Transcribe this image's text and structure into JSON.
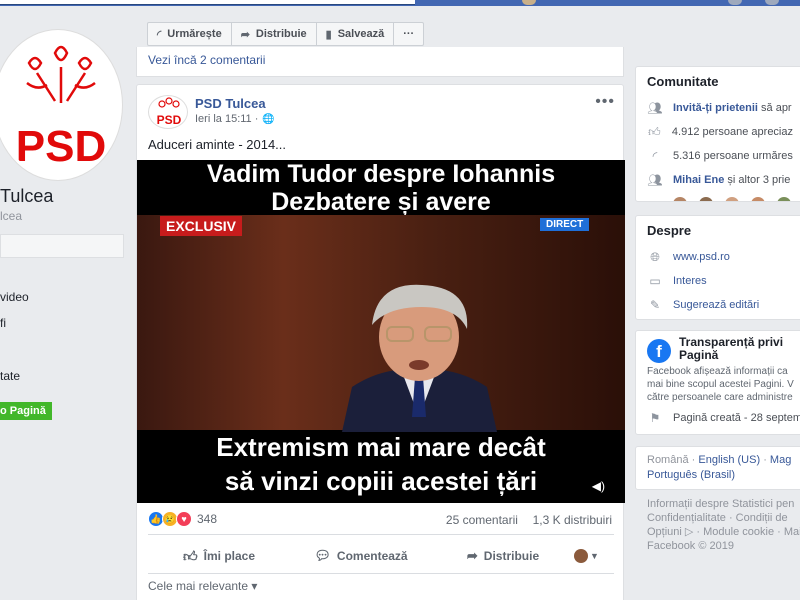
{
  "left": {
    "page_name": "Tulcea",
    "page_handle": "lcea",
    "nav": [
      "video",
      "fi",
      "tate"
    ],
    "create_page_label": "o Pagină"
  },
  "action_bar": {
    "follow": "Urmărește",
    "share": "Distribuie",
    "save": "Salvează",
    "more": "···"
  },
  "prev_post": {
    "more_comments": "Vezi încă 2 comentarii"
  },
  "post": {
    "author": "PSD Tulcea",
    "time": "Ieri la 15:11 ·",
    "text": "Aduceri aminte - 2014...",
    "video": {
      "title_line1": "Vadim Tudor despre Iohannis",
      "title_line2": "Dezbatere și avere",
      "tag_exclusive": "EXCLUSIV",
      "tag_direct": "DIRECT",
      "caption_line1": "Extremism mai mare decât",
      "caption_line2": "să vinzi copiii acestei țări"
    },
    "reaction_count": "348",
    "comments": "25 comentarii",
    "shares": "1,3 K distribuiri",
    "actions": {
      "like": "Îmi place",
      "comment": "Comentează",
      "share": "Distribuie"
    },
    "sort_label": "Cele mai relevante ▾",
    "logo_text": "PSD"
  },
  "community": {
    "title": "Comunitate",
    "invite": "Invită-ți prietenii",
    "invite_suffix": " să apr",
    "likes": "4.912 persoane apreciaz",
    "followers": "5.316 persoane urmăres",
    "friends_prefix": "Mihai Ene",
    "friends_suffix": " și altor 3 prie"
  },
  "about": {
    "title": "Despre",
    "website": "www.psd.ro",
    "category": "Interes",
    "suggest": "Sugerează editări"
  },
  "transparency": {
    "title_line1": "Transparență privi",
    "title_line2": "Pagină",
    "desc_line1": "Facebook afișează informații ca",
    "desc_line2": "mai bine scopul acestei Pagini. V",
    "desc_line3": "către persoanele care administre",
    "created": "Pagină creată - 28 septem"
  },
  "languages": {
    "line1_a": "Română",
    "line1_b": "English (US)",
    "line1_c": "Mag",
    "line2": "Português (Brasil)"
  },
  "footer": {
    "line1": "Informații despre Statistici pen",
    "line2": "Confidențialitate · Condiții de",
    "line3": "Opțiuni ▷ · Module cookie · Mai",
    "line4": "Facebook © 2019"
  },
  "colors": {
    "brand": "#4267b2",
    "link": "#385898",
    "psd_red": "#e10a0a",
    "green": "#42b72a"
  }
}
